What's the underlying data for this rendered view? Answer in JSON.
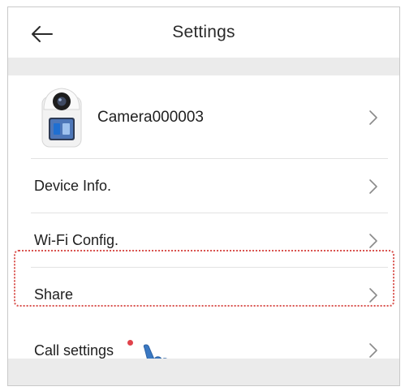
{
  "header": {
    "title": "Settings",
    "back_icon": "arrow-left-icon"
  },
  "device": {
    "name": "Camera000003",
    "thumbnail_icon": "camera-device-icon"
  },
  "menu": {
    "device_info": "Device Info.",
    "wifi_config": "Wi-Fi Config.",
    "share": "Share",
    "call_settings": "Call settings"
  },
  "annotations": {
    "highlight_color": "#d9534f",
    "badge_color": "#e0434b",
    "pointer_icon": "tap-hand-icon",
    "pointer_color": "#3a78c2"
  },
  "colors": {
    "band": "#ebebeb",
    "divider": "#e2e2e2",
    "text": "#202020"
  }
}
